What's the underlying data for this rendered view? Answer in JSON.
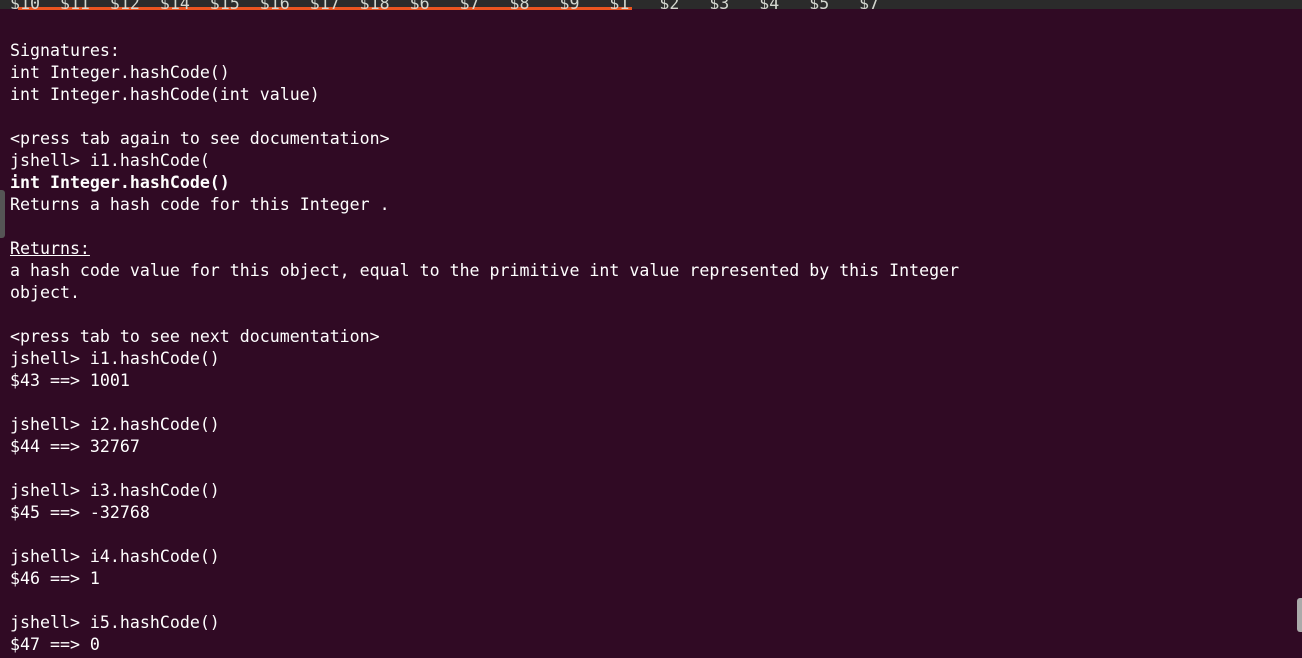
{
  "window": {
    "top_cutoff_text": "$10  $11  $12  $14  $15  $16  $17  $18  $6   $7   $8   $9   $1   $2   $3   $4   $5   $7"
  },
  "terminal": {
    "lines": [
      {
        "text": "Signatures:",
        "style": ""
      },
      {
        "text": "int Integer.hashCode()",
        "style": ""
      },
      {
        "text": "int Integer.hashCode(int value)",
        "style": ""
      },
      {
        "text": "",
        "style": ""
      },
      {
        "text": "<press tab again to see documentation>",
        "style": ""
      },
      {
        "text": "jshell> i1.hashCode(",
        "style": ""
      },
      {
        "text": "int Integer.hashCode()",
        "style": "bold"
      },
      {
        "text": "Returns a hash code for this Integer .",
        "style": ""
      },
      {
        "text": "",
        "style": ""
      },
      {
        "text": "Returns:",
        "style": "uline"
      },
      {
        "text": "a hash code value for this object, equal to the primitive int value represented by this Integer",
        "style": ""
      },
      {
        "text": "object.",
        "style": ""
      },
      {
        "text": "",
        "style": ""
      },
      {
        "text": "<press tab to see next documentation>",
        "style": ""
      },
      {
        "text": "jshell> i1.hashCode()",
        "style": ""
      },
      {
        "text": "$43 ==> 1001",
        "style": ""
      },
      {
        "text": "",
        "style": ""
      },
      {
        "text": "jshell> i2.hashCode()",
        "style": ""
      },
      {
        "text": "$44 ==> 32767",
        "style": ""
      },
      {
        "text": "",
        "style": ""
      },
      {
        "text": "jshell> i3.hashCode()",
        "style": ""
      },
      {
        "text": "$45 ==> -32768",
        "style": ""
      },
      {
        "text": "",
        "style": ""
      },
      {
        "text": "jshell> i4.hashCode()",
        "style": ""
      },
      {
        "text": "$46 ==> 1",
        "style": ""
      },
      {
        "text": "",
        "style": ""
      },
      {
        "text": "jshell> i5.hashCode()",
        "style": ""
      },
      {
        "text": "$47 ==> 0",
        "style": ""
      }
    ]
  },
  "colors": {
    "background": "#300a24",
    "text": "#ffffff",
    "accent": "#e95420"
  }
}
